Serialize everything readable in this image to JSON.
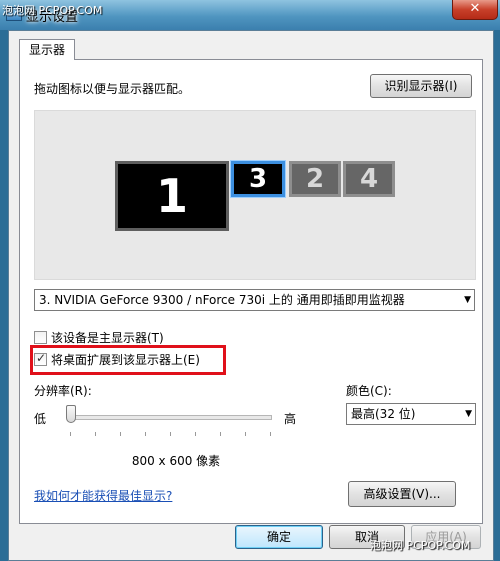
{
  "watermark_top": "泡泡网 PCPOP.COM",
  "watermark_bottom": "泡泡网 PCPOP.COM",
  "window": {
    "title": "显示设置",
    "close_glyph": "✕"
  },
  "tab": {
    "label": "显示器"
  },
  "instruction": "拖动图标以便与显示器匹配。",
  "identify_button": "识别显示器(I)",
  "monitors": [
    {
      "number": "1",
      "state": "active"
    },
    {
      "number": "3",
      "state": "selected"
    },
    {
      "number": "2",
      "state": "inactive"
    },
    {
      "number": "4",
      "state": "inactive"
    }
  ],
  "display_select": {
    "value": "3. NVIDIA GeForce 9300 / nForce 730i 上的 通用即插即用监视器"
  },
  "checkboxes": {
    "primary": {
      "label": "该设备是主显示器(T)",
      "checked": false
    },
    "extend": {
      "label": "将桌面扩展到该显示器上(E)",
      "checked": true
    }
  },
  "resolution": {
    "label": "分辨率(R):",
    "low": "低",
    "high": "高",
    "value": "800 x 600 像素",
    "slider_position": 0.0
  },
  "color": {
    "label": "颜色(C):",
    "value": "最高(32 位)"
  },
  "help_link": "我如何才能获得最佳显示?",
  "advanced_button": "高级设置(V)...",
  "ok_button": "确定",
  "cancel_button": "取消",
  "apply_button": "应用(A)",
  "colors": {
    "highlight": "#e0101a",
    "selected_monitor_border": "#3c8fe0",
    "link": "#1a4fb5"
  },
  "icons": {
    "dropdown": "chevron-down-icon",
    "check": "checkmark-icon"
  }
}
